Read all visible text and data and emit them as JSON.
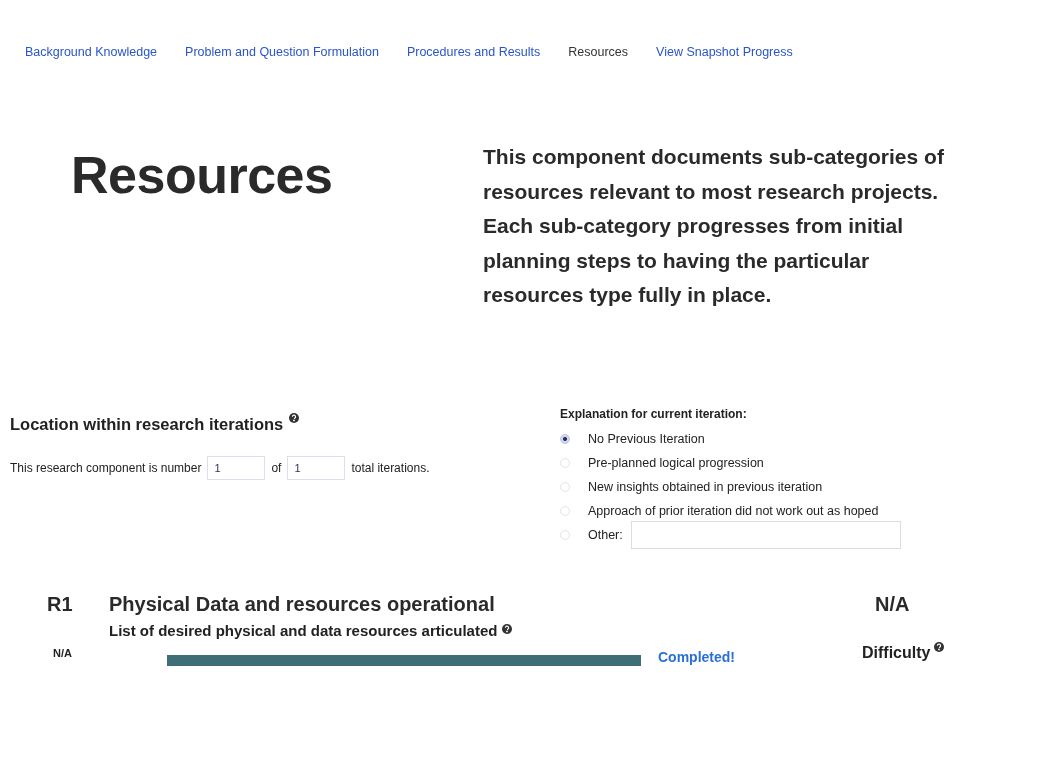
{
  "nav": [
    {
      "label": "Background Knowledge",
      "selected": false
    },
    {
      "label": "Problem and Question Formulation",
      "selected": false
    },
    {
      "label": "Procedures and Results",
      "selected": false
    },
    {
      "label": "Resources",
      "selected": true
    },
    {
      "label": "View Snapshot Progress",
      "selected": false
    }
  ],
  "heading": "Resources",
  "description": "This component documents sub-categories of resources relevant to most research projects. Each sub-category progresses from initial planning steps to having the particular resources type fully in place.",
  "location": {
    "title": "Location within research iterations",
    "sentence_start": "This research component is number",
    "number": "1",
    "of": "of",
    "total": "1",
    "sentence_end": "total iterations."
  },
  "explanation": {
    "title": "Explanation for current iteration:",
    "options": [
      {
        "label": "No Previous Iteration",
        "selected": true
      },
      {
        "label": "Pre-planned logical progression",
        "selected": false
      },
      {
        "label": "New insights obtained in previous iteration",
        "selected": false
      },
      {
        "label": "Approach of prior iteration did not work out as hoped",
        "selected": false
      },
      {
        "label": "Other:",
        "selected": false,
        "kind": "text"
      }
    ]
  },
  "component": {
    "code": "R1",
    "title": "Physical Data and resources operational",
    "rating": "N/A",
    "item": "List of desired physical and data resources articulated",
    "item_rating": "N/A",
    "level": 1,
    "status": "Completed!",
    "difficulty": "Difficulty"
  }
}
